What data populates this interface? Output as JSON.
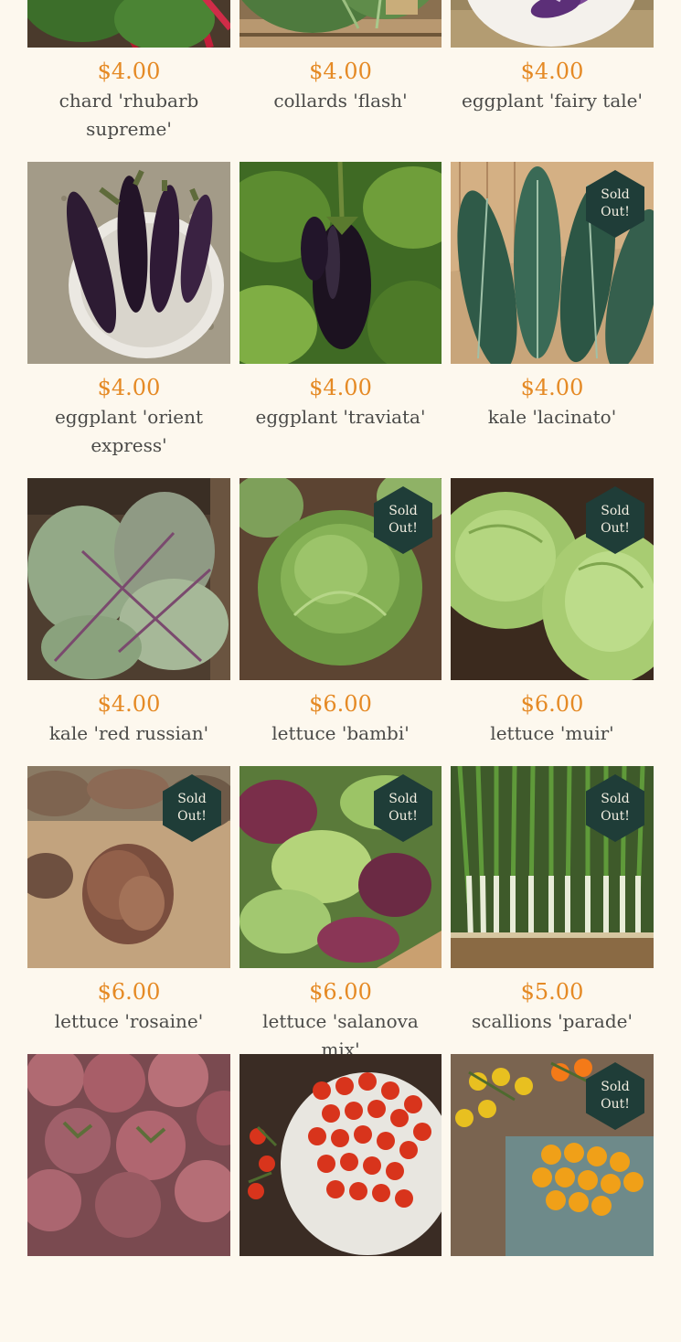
{
  "products": [
    {
      "price": "$4.00",
      "name": "chard 'rhubarb supreme'",
      "sold_out": false,
      "scene": "chard"
    },
    {
      "price": "$4.00",
      "name": "collards 'flash'",
      "sold_out": false,
      "scene": "collards"
    },
    {
      "price": "$4.00",
      "name": "eggplant 'fairy tale'",
      "sold_out": false,
      "scene": "fairytale"
    },
    {
      "price": "$4.00",
      "name": "eggplant 'orient express'",
      "sold_out": false,
      "scene": "orient"
    },
    {
      "price": "$4.00",
      "name": "eggplant 'traviata'",
      "sold_out": false,
      "scene": "traviata"
    },
    {
      "price": "$4.00",
      "name": "kale 'lacinato'",
      "sold_out": true,
      "scene": "lacinato"
    },
    {
      "price": "$4.00",
      "name": "kale 'red russian'",
      "sold_out": false,
      "scene": "redrussian"
    },
    {
      "price": "$6.00",
      "name": "lettuce 'bambi'",
      "sold_out": true,
      "scene": "bambi"
    },
    {
      "price": "$6.00",
      "name": "lettuce 'muir'",
      "sold_out": true,
      "scene": "muir"
    },
    {
      "price": "$6.00",
      "name": "lettuce 'rosaine'",
      "sold_out": true,
      "scene": "rosaine"
    },
    {
      "price": "$6.00",
      "name": "lettuce 'salanova mix'",
      "sold_out": true,
      "scene": "salanova"
    },
    {
      "price": "$5.00",
      "name": "scallions 'parade'",
      "sold_out": true,
      "scene": "scallions"
    },
    {
      "price": "",
      "name": "",
      "sold_out": false,
      "scene": "tomatoes"
    },
    {
      "price": "",
      "name": "",
      "sold_out": false,
      "scene": "cherrytomatoes"
    },
    {
      "price": "",
      "name": "",
      "sold_out": true,
      "scene": "orangetomatoes"
    }
  ],
  "badge": {
    "label": "Sold\nOut!"
  },
  "colors": {
    "background": "#fdf8ee",
    "price": "#e58a25",
    "name": "#4a4a48",
    "badge": "#1f3d38"
  }
}
